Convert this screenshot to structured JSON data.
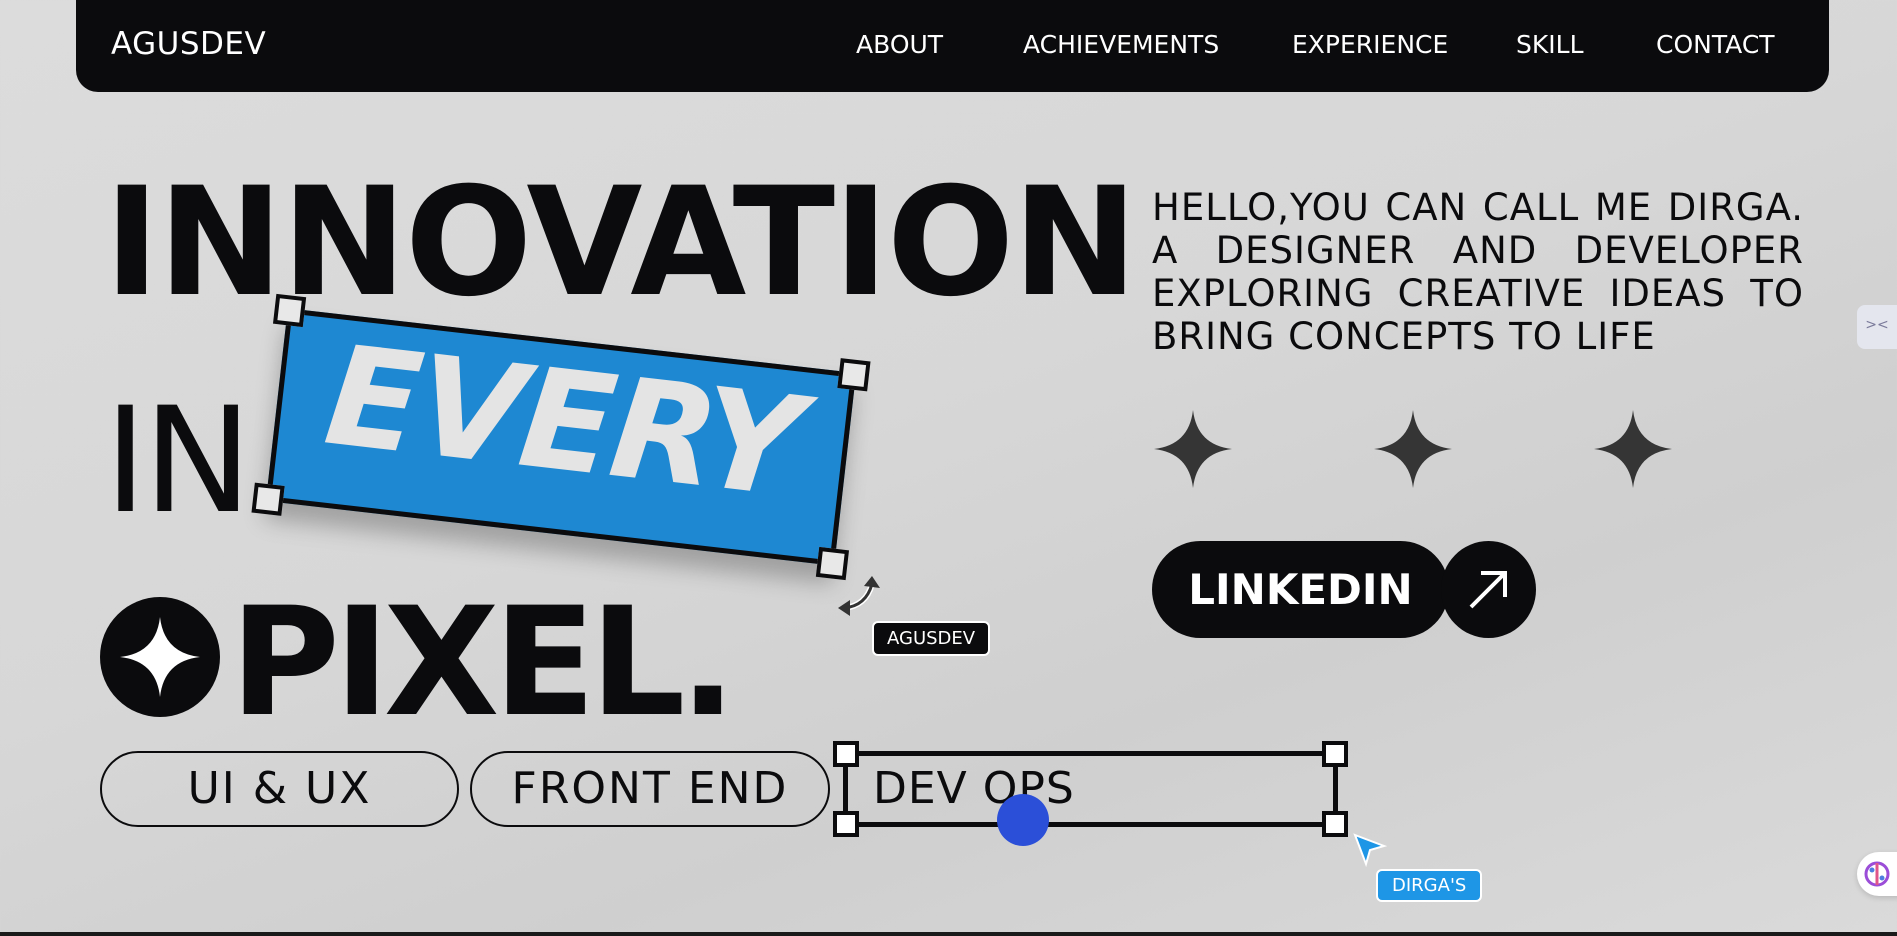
{
  "nav": {
    "brand": "AGUSDEV",
    "links": [
      "ABOUT",
      "ACHIEVEMENTS",
      "EXPERIENCE",
      "SKILL",
      "CONTACT"
    ]
  },
  "hero": {
    "line1": "INNOVATION",
    "line2_prefix": "IN",
    "line2_highlight": "EVERY",
    "line3": "PIXEL.",
    "cursor_tag_1": "AGUSDEV",
    "cursor_tag_2": "DIRGA'S"
  },
  "pills": [
    "UI & UX",
    "FRONT END",
    "DEV OPS"
  ],
  "intro": "HELLO,YOU CAN CALL ME DIRGA. A DESIGNER AND DEVELOPER EXPLORING CREATIVE IDEAS TO BRING CONCEPTS TO LIFE",
  "cta": {
    "linkedin": "LINKEDIN"
  },
  "colors": {
    "nav_bg": "#0b0b0d",
    "highlight_blue": "#1e88d2",
    "dot_blue": "#2b4fd8",
    "tag_blue": "#1e96e6"
  },
  "icons": [
    "sparkle-star-icon",
    "arrow-up-right-icon",
    "rotate-icon",
    "cursor-arrow-icon",
    "brain-icon"
  ]
}
